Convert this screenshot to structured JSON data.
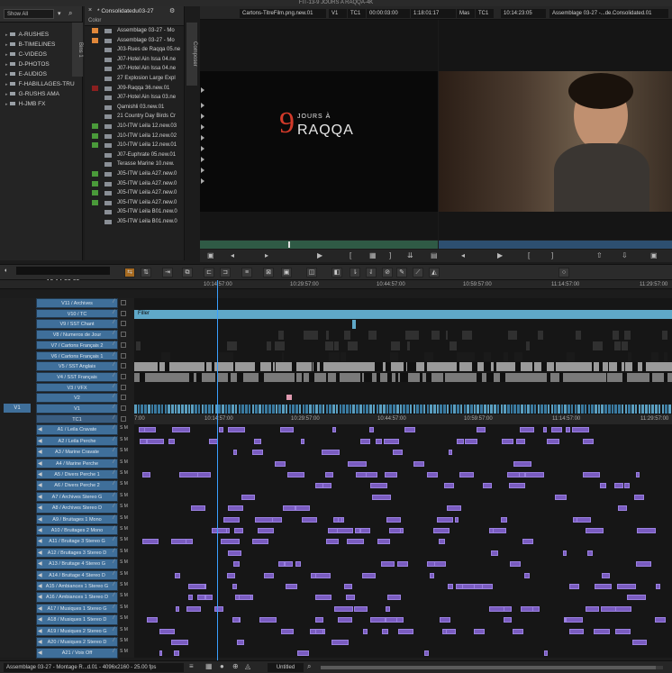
{
  "window": {
    "title": "FIT-13-9 JOURS A RAQQA-4K"
  },
  "bin_panel": {
    "show_select": "Show All",
    "folders": [
      "A-RUSHES",
      "B-TIMELINES",
      "C-VIDEOS",
      "D-PHOTOS",
      "E-AUDIOS",
      "F-HABILLAGES-TRU",
      "G-RUSHS AMA",
      "H-JMB FX"
    ],
    "bins_tab": "Bins 1"
  },
  "clip_panel": {
    "title": "* Consolidatedu03-27",
    "color_header": "Color",
    "clips": [
      {
        "name": "Assemblage 03-27 - Mo",
        "color": "#e0873a"
      },
      {
        "name": "Assemblage 03-27 - Mo",
        "color": "#e0873a"
      },
      {
        "name": "J03-Rues de Raqqa 05.ne",
        "color": ""
      },
      {
        "name": "J07-Hotel Ain Issa 04.ne",
        "color": ""
      },
      {
        "name": "J07-Hotel Ain Issa 04.ne",
        "color": ""
      },
      {
        "name": "27 Explosion Large Expl",
        "color": ""
      },
      {
        "name": "J09-Raqqa 36.new.01",
        "color": "#8a1f1f"
      },
      {
        "name": "J07-Hotel Ain Issa 03.ne",
        "color": ""
      },
      {
        "name": "Qamishli 03.new.01",
        "color": ""
      },
      {
        "name": "21 Country Day Birds Cr",
        "color": ""
      },
      {
        "name": "J10-ITW Leila 12.new.03",
        "color": "#4a9a3a"
      },
      {
        "name": "J10-ITW Leila 12.new.02",
        "color": "#4a9a3a"
      },
      {
        "name": "J10-ITW Leila 12.new.01",
        "color": "#4a9a3a"
      },
      {
        "name": "J07-Euphrate 05.new.01",
        "color": ""
      },
      {
        "name": "Terasse Marine 10.new.",
        "color": ""
      },
      {
        "name": "J05-ITW Leila A27.new.0",
        "color": "#4a9a3a"
      },
      {
        "name": "J05-ITW Leila A27.new.0",
        "color": "#4a9a3a"
      },
      {
        "name": "J05-ITW Leila A27.new.0",
        "color": "#4a9a3a"
      },
      {
        "name": "J05-ITW Leila A27.new.0",
        "color": "#4a9a3a"
      },
      {
        "name": "J05-ITW Leila B01.new.0",
        "color": ""
      },
      {
        "name": "J05-ITW Leila B01.new.0",
        "color": ""
      }
    ]
  },
  "composer": {
    "tab": "Composer",
    "source_clip": "Cartons-TitreFilm.png.new.01",
    "source_track": "V1",
    "source_tc_label": "TC1",
    "source_tc": "00:00:03:00",
    "duration": "1:18:01:17",
    "mas_label": "Mas",
    "record_tc_label": "TC1",
    "record_tc": "10:14:23:05",
    "record_seq": "Assemblage 03-27 -...de.Consolidated.01",
    "logo_number": "9",
    "logo_top": "JOURS À",
    "logo_main": "RAQQA"
  },
  "timeline": {
    "timecode": "10:14:23:05",
    "ruler_labels": [
      "10:14:57:00",
      "10:29:57:00",
      "10:44:57:00",
      "10:59:57:00",
      "11:14:57:00",
      "11:29:57:00"
    ],
    "mid_ruler_labels": [
      "7:00",
      "10:14:57:00",
      "10:29:57:00",
      "10:44:57:00",
      "10:59:57:00",
      "11:14:57:00",
      "11:29:57:00"
    ],
    "filler_label": "Filler",
    "v1_source": "V1",
    "video_tracks": [
      "V11 / Archives",
      "V10 / TC",
      "V9 / SST Chant",
      "V8 / Numeros de Jour",
      "V7 / Cartons Français 2",
      "V6 / Cartons Français 1",
      "V5 / SST Anglais",
      "V4 / SST Français",
      "V3 / VFX",
      "V2",
      "V1",
      "TC1"
    ],
    "audio_tracks": [
      "A1 / Leila Cravate",
      "A2 / Leila Perche",
      "A3 / Marine Cravate",
      "A4 / Marine Perche",
      "A5 / Divers Perche 1",
      "A6 / Divers Perche 2",
      "A7 / Archives Stereo G",
      "A8 / Archives Stereo D",
      "A9 / Bruitages 1 Mono",
      "A10 / Bruitages 2 Mono",
      "A11 / Bruitage 3 Stereo G",
      "A12 / Bruitages 3 Stereo D",
      "A13 / Bruitage 4 Stereo G",
      "A14 / Bruitage 4 Stereo D",
      "A15 / Ambiances 1 Stereo G",
      "A16 / Ambiances 1 Stereo D",
      "A17 / Musiques 1 Stereo G",
      "A18 / Musiques 1 Stereo D",
      "A19 / Musiques 2 Stereo G",
      "A20 / Musiques 2 Stereo D",
      "A21 / Voix Off"
    ]
  },
  "status": {
    "sequence_info": "Assemblage 03-27 - Montage R...d.01 - 4096x2160 - 25.00 fps",
    "project": "Untitled"
  }
}
